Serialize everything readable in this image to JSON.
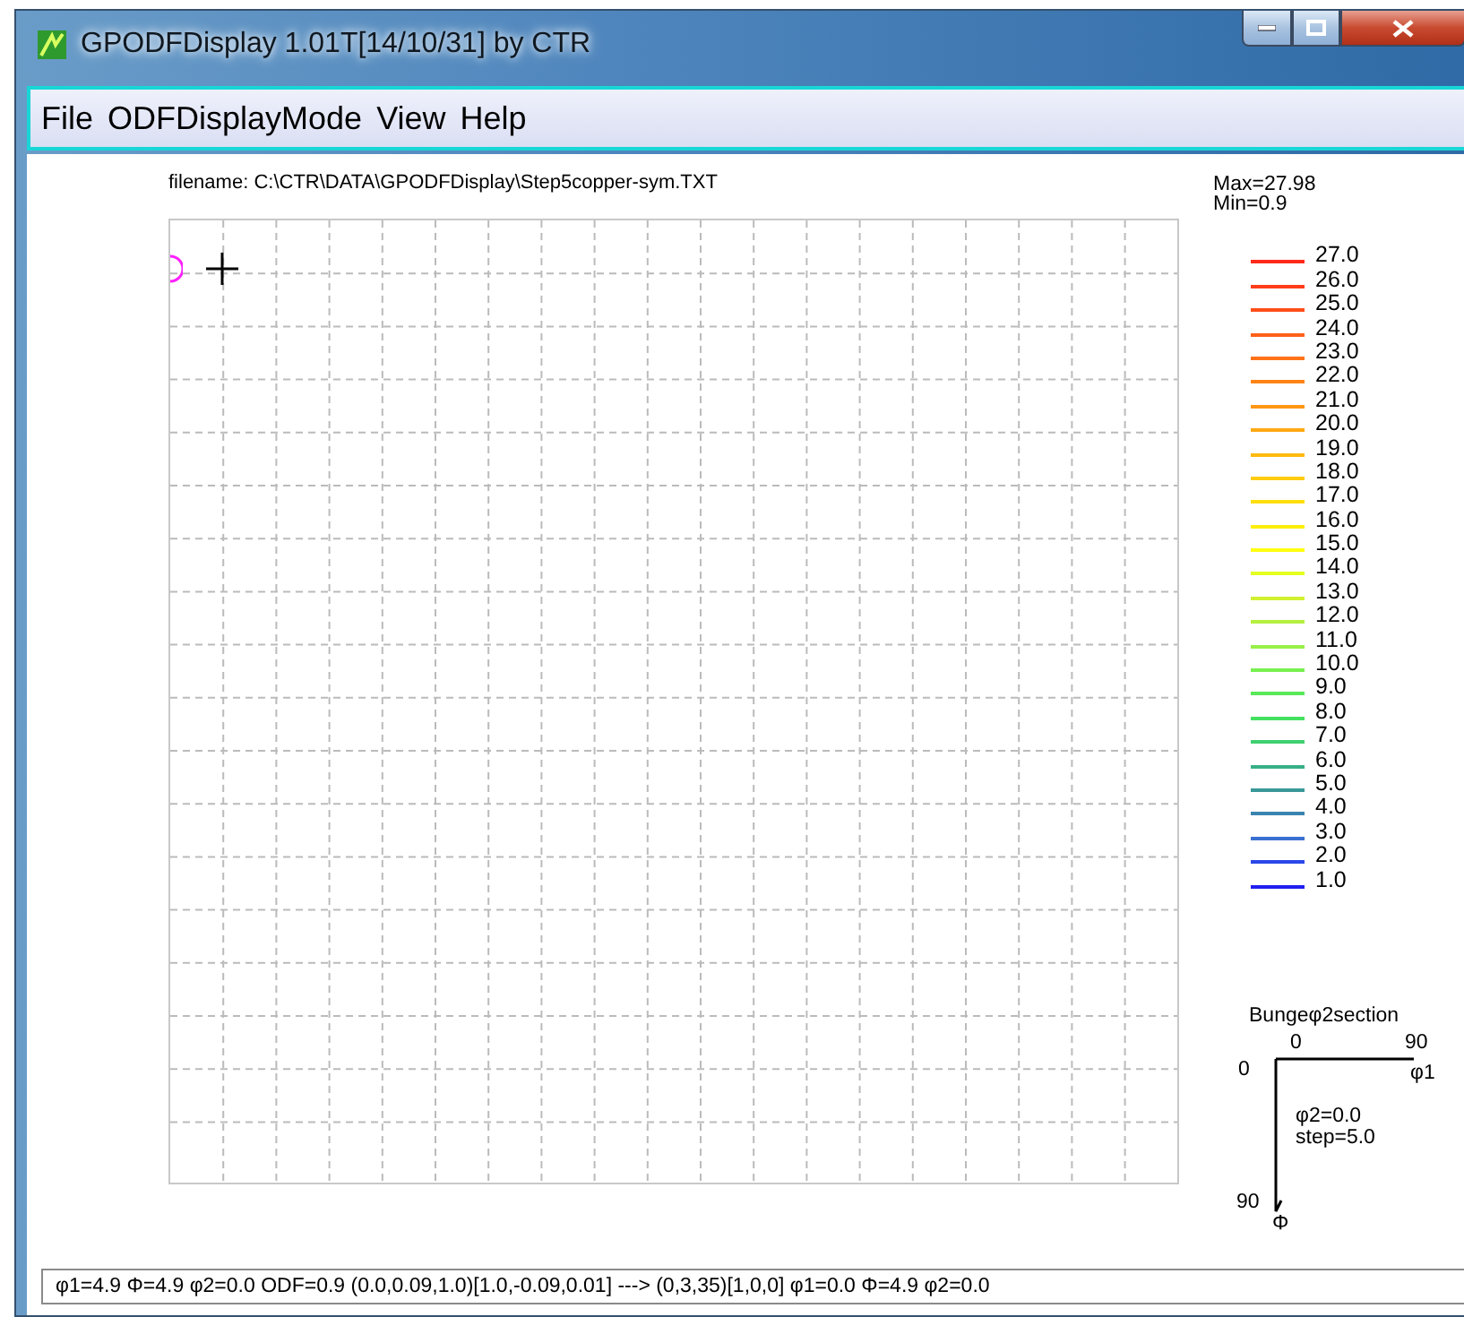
{
  "window": {
    "title": "GPODFDisplay 1.01T[14/10/31] by CTR"
  },
  "menu": [
    "File",
    "ODFDisplayMode",
    "View",
    "Help"
  ],
  "plot": {
    "filename": "filename: C:\\CTR\\DATA\\GPODFDisplay\\Step5copper-sym.TXT"
  },
  "legend": {
    "max": "Max=27.98",
    "min": "Min=0.9",
    "items": [
      {
        "label": "27.0",
        "color": "#ff2a1a"
      },
      {
        "label": "26.0",
        "color": "#ff3c1a"
      },
      {
        "label": "25.0",
        "color": "#ff4e1a"
      },
      {
        "label": "24.0",
        "color": "#ff601a"
      },
      {
        "label": "23.0",
        "color": "#ff7218"
      },
      {
        "label": "22.0",
        "color": "#ff8416"
      },
      {
        "label": "21.0",
        "color": "#ff9614"
      },
      {
        "label": "20.0",
        "color": "#ffa812"
      },
      {
        "label": "19.0",
        "color": "#ffba10"
      },
      {
        "label": "18.0",
        "color": "#ffcc0e"
      },
      {
        "label": "17.0",
        "color": "#ffde0c"
      },
      {
        "label": "16.0",
        "color": "#ffee0a"
      },
      {
        "label": "15.0",
        "color": "#ffff10"
      },
      {
        "label": "14.0",
        "color": "#e4ff20"
      },
      {
        "label": "13.0",
        "color": "#d0f030"
      },
      {
        "label": "12.0",
        "color": "#b4f040"
      },
      {
        "label": "11.0",
        "color": "#98f048"
      },
      {
        "label": "10.0",
        "color": "#78f050"
      },
      {
        "label": "9.0",
        "color": "#58e858"
      },
      {
        "label": "8.0",
        "color": "#44e060"
      },
      {
        "label": "7.0",
        "color": "#40d070"
      },
      {
        "label": "6.0",
        "color": "#38b088"
      },
      {
        "label": "5.0",
        "color": "#3a9898"
      },
      {
        "label": "4.0",
        "color": "#3a84b0"
      },
      {
        "label": "3.0",
        "color": "#3a70d0"
      },
      {
        "label": "2.0",
        "color": "#2a48e8"
      },
      {
        "label": "1.0",
        "color": "#2020f0"
      }
    ]
  },
  "section": {
    "title": "Bungeφ2section",
    "x_start": "0",
    "x_end": "90",
    "x_axis": "φ1",
    "y_start": "0",
    "y_end": "90",
    "y_axis": "Φ",
    "phi2": "φ2=0.0",
    "step": "step=5.0"
  },
  "status_bar": "φ1=4.9 Φ=4.9 φ2=0.0 ODF=0.9  (0.0,0.09,1.0)[1.0,-0.09,0.01] ---> (0,3,35)[1,0,0]  φ1=0.0 Φ=4.9 φ2=0.0"
}
